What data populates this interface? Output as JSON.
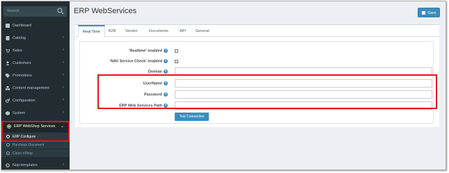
{
  "sidebar": {
    "search_placeholder": "Search",
    "items": [
      {
        "label": "Dashboard",
        "icon": "dashboard-icon",
        "chevron": ""
      },
      {
        "label": "Catalog",
        "icon": "book-icon",
        "chevron": "‹"
      },
      {
        "label": "Sales",
        "icon": "cart-icon",
        "chevron": "‹"
      },
      {
        "label": "Customers",
        "icon": "user-icon",
        "chevron": "‹"
      },
      {
        "label": "Promotions",
        "icon": "tag-icon",
        "chevron": "‹"
      },
      {
        "label": "Content management",
        "icon": "cubes-icon",
        "chevron": "‹"
      },
      {
        "label": "Configuration",
        "icon": "gears-icon",
        "chevron": "‹"
      },
      {
        "label": "System",
        "icon": "cube-icon",
        "chevron": "‹"
      },
      {
        "label": "ERP WebShop Services",
        "icon": "dot-circle-icon",
        "chevron": "⌄"
      }
    ],
    "sub_items": [
      {
        "label": "ERP Configure"
      },
      {
        "label": "Purchase Document"
      },
      {
        "label": "Clean eShop"
      }
    ],
    "last_item": {
      "label": "Nop-templates",
      "icon": "gear-icon",
      "chevron": "‹"
    }
  },
  "header": {
    "title": "ERP WebServices",
    "save_label": "Save"
  },
  "tabs": [
    "Real Time",
    "B2B",
    "Vendor",
    "Documents",
    "API",
    "General"
  ],
  "form": {
    "realtime_label": "'Realtime' enabled",
    "nav_check_label": "'NAV Service Check' enabled",
    "domain_label": "Domian",
    "username_label": "UserName",
    "password_label": "Password",
    "path_label": "ERP Web Services Path",
    "test_button": "Test Connection"
  },
  "colors": {
    "accent": "#3c8dbc",
    "highlight": "#e3141b",
    "sidebar_bg": "#222d32"
  }
}
